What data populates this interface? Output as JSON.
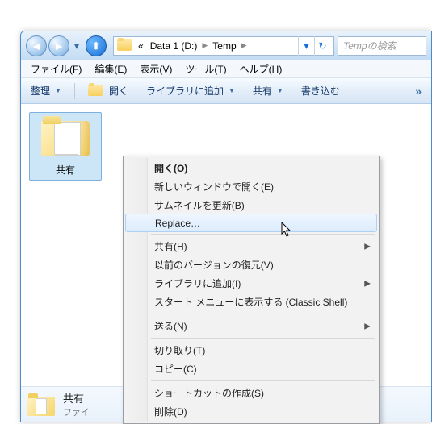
{
  "address": {
    "root_glyph": "«",
    "path1": "Data 1 (D:)",
    "path2": "Temp",
    "search_placeholder": "Tempの検索"
  },
  "menubar": {
    "file": "ファイル(F)",
    "edit": "編集(E)",
    "view": "表示(V)",
    "tools": "ツール(T)",
    "help": "ヘルプ(H)"
  },
  "toolbar": {
    "organize": "整理",
    "open": "開く",
    "add_to_library": "ライブラリに追加",
    "share": "共有",
    "burn": "書き込む"
  },
  "item": {
    "name": "共有"
  },
  "details": {
    "name": "共有",
    "type": "ファイ"
  },
  "ctx": {
    "open": "開く(O)",
    "open_new_window": "新しいウィンドウで開く(E)",
    "refresh_thumb": "サムネイルを更新(B)",
    "replace": "Replace…",
    "share": "共有(H)",
    "restore_prev": "以前のバージョンの復元(V)",
    "add_library": "ライブラリに追加(I)",
    "startmenu_classic": "スタート メニューに表示する (Classic Shell)",
    "send_to": "送る(N)",
    "cut": "切り取り(T)",
    "copy": "コピー(C)",
    "shortcut": "ショートカットの作成(S)",
    "delete": "削除(D)"
  }
}
